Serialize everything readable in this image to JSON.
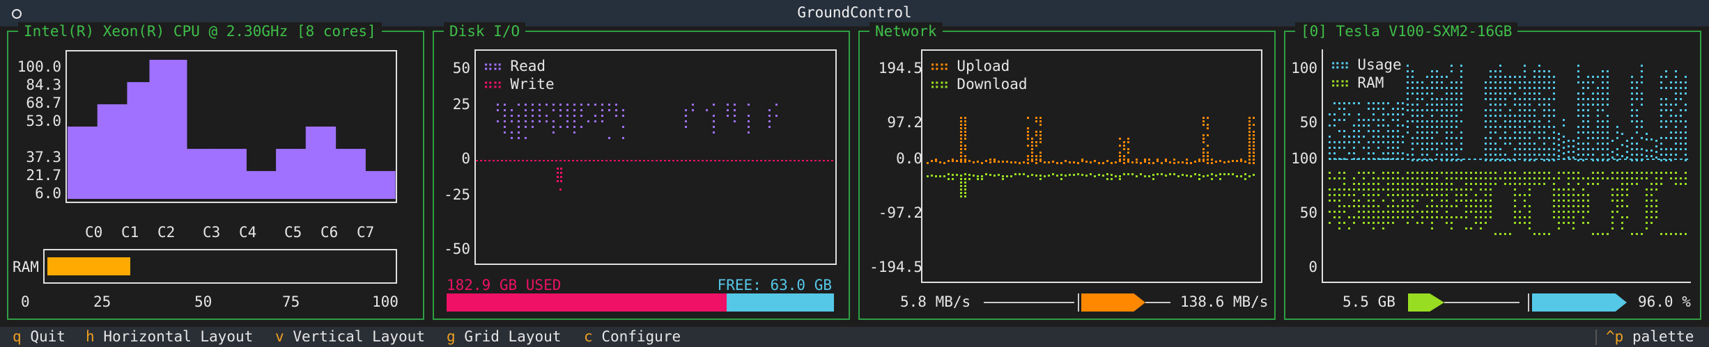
{
  "window": {
    "title": "GroundControl"
  },
  "cpu": {
    "title": "Intel(R) Xeon(R) CPU @ 2.30GHz [8 cores]",
    "y_ticks": [
      "100.0",
      "84.3",
      "68.7",
      "53.0",
      "37.3",
      "21.7",
      "6.0"
    ],
    "cores": [
      "C0",
      "C1",
      "C2",
      "C3",
      "C4",
      "C5",
      "C6",
      "C7"
    ],
    "ram_label": "RAM",
    "ram_ticks": [
      "0",
      "25",
      "50",
      "75",
      "100"
    ],
    "colors": {
      "bars": "#a070ff",
      "ram": "#ffaa00"
    }
  },
  "disk": {
    "title": "Disk I/O",
    "y_ticks": [
      "50",
      "25",
      "0",
      "-25",
      "-50"
    ],
    "legend_read": "Read",
    "legend_write": "Write",
    "used_label": "182.9 GB USED",
    "free_label": "FREE: 63.0 GB",
    "colors": {
      "read": "#a070ff",
      "write": "#ee1166",
      "used": "#ee1166",
      "free": "#55c8e8"
    }
  },
  "network": {
    "title": "Network",
    "y_ticks": [
      "194.5",
      "97.2",
      "0.0",
      "-97.2",
      "-194.5"
    ],
    "legend_upload": "Upload",
    "legend_download": "Download",
    "left_value": "5.8 MB/s",
    "right_value": "138.6 MB/s",
    "colors": {
      "upload": "#ff8800",
      "download": "#99dd22"
    }
  },
  "gpu": {
    "title": "[0] Tesla V100-SXM2-16GB",
    "y_ticks_top": [
      "100",
      "50"
    ],
    "y_ticks_mid": [
      "100"
    ],
    "y_ticks_bottom": [
      "50",
      "0"
    ],
    "legend_usage": "Usage",
    "legend_ram": "RAM",
    "left_value": "5.5 GB",
    "right_value": "96.0 %",
    "colors": {
      "usage": "#55c8e8",
      "ram": "#99dd22"
    }
  },
  "statusbar": {
    "items": [
      {
        "key": "q",
        "label": "Quit"
      },
      {
        "key": "h",
        "label": "Horizontal Layout"
      },
      {
        "key": "v",
        "label": "Vertical Layout"
      },
      {
        "key": "g",
        "label": "Grid Layout"
      },
      {
        "key": "c",
        "label": "Configure"
      }
    ],
    "palette_key": "^p",
    "palette_label": "palette"
  },
  "chart_data": [
    {
      "type": "bar",
      "categories": [
        "C0",
        "C1",
        "C2",
        "C3",
        "C4",
        "C5",
        "C6",
        "C7"
      ],
      "values": [
        53.0,
        68.7,
        84.3,
        100.0,
        37.3,
        37.3,
        21.7,
        37.3,
        53.0,
        37.3,
        21.7
      ],
      "ylim": [
        6.0,
        100.0
      ]
    },
    {
      "type": "bar",
      "categories": [
        "RAM"
      ],
      "values": [
        27
      ],
      "ylim": [
        0,
        100
      ]
    }
  ]
}
